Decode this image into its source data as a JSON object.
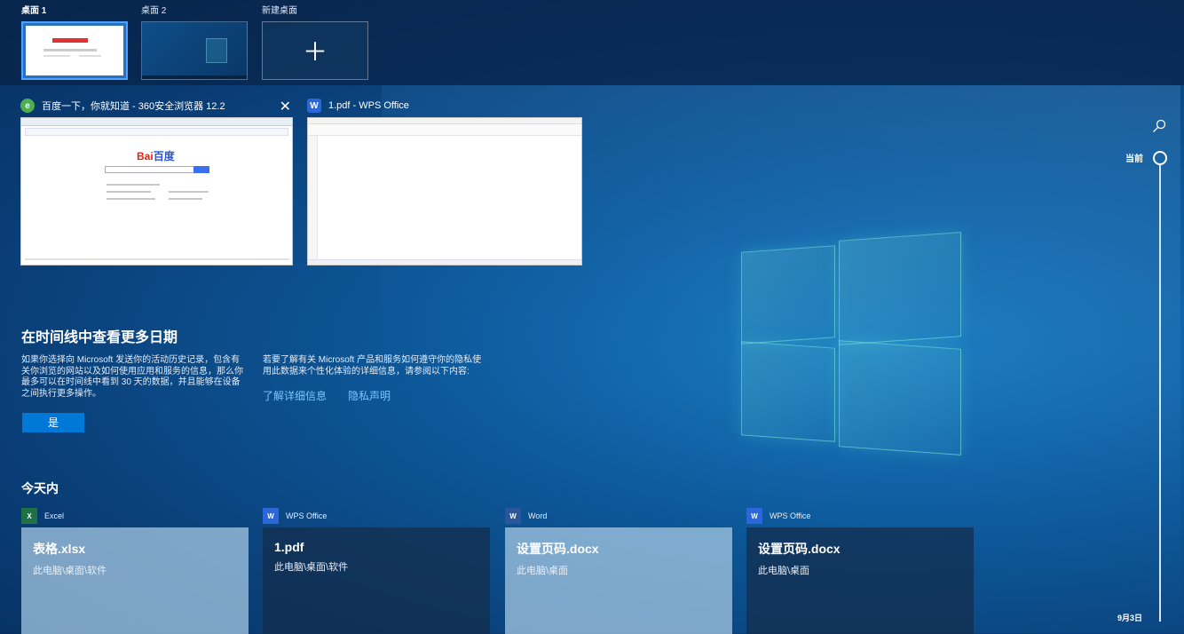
{
  "desktops": [
    {
      "label": "桌面 1"
    },
    {
      "label": "桌面 2"
    },
    {
      "label": "新建桌面",
      "icon": "plus-icon"
    }
  ],
  "windows": [
    {
      "title": "百度一下，你就知道 - 360安全浏览器 12.2",
      "icon": "360-browser-icon"
    },
    {
      "title": "1.pdf - WPS Office",
      "icon": "wps-icon"
    }
  ],
  "promo": {
    "title": "在时间线中查看更多日期",
    "text_left": "如果你选择向 Microsoft 发送你的活动历史记录，包含有关你浏览的网站以及如何使用应用和服务的信息，那么你最多可以在时间线中看到 30 天的数据，并且能够在设备之间执行更多操作。",
    "text_right": "若要了解有关 Microsoft 产品和服务如何遵守你的隐私使用此数据来个性化体验的详细信息，请参阅以下内容:",
    "link_more": "了解详细信息",
    "link_privacy": "隐私声明",
    "yes_label": "是"
  },
  "today": {
    "title": "今天内",
    "activities": [
      {
        "app": "Excel",
        "name": "表格.xlsx",
        "path": "此电脑\\桌面\\软件",
        "icon": "excel-icon",
        "color": "#1e7145"
      },
      {
        "app": "WPS Office",
        "name": "1.pdf",
        "path": "此电脑\\桌面\\软件",
        "icon": "wps-icon",
        "color": "#2b67d8"
      },
      {
        "app": "Word",
        "name": "设置页码.docx",
        "path": "此电脑\\桌面",
        "icon": "word-icon",
        "color": "#2b579a"
      },
      {
        "app": "WPS Office",
        "name": "设置页码.docx",
        "path": "此电脑\\桌面",
        "icon": "wps-icon",
        "color": "#2b67d8"
      }
    ]
  },
  "timeline": {
    "now_label": "当前",
    "date_label": "9月3日",
    "search_icon": "search-icon"
  },
  "thumb_text": {
    "baidu_bai": "Bai",
    "baidu_du": "百度"
  },
  "icons": {
    "plus": "＋",
    "close": "✕",
    "e360": "e",
    "wps": "W",
    "excel": "X",
    "word": "W"
  }
}
